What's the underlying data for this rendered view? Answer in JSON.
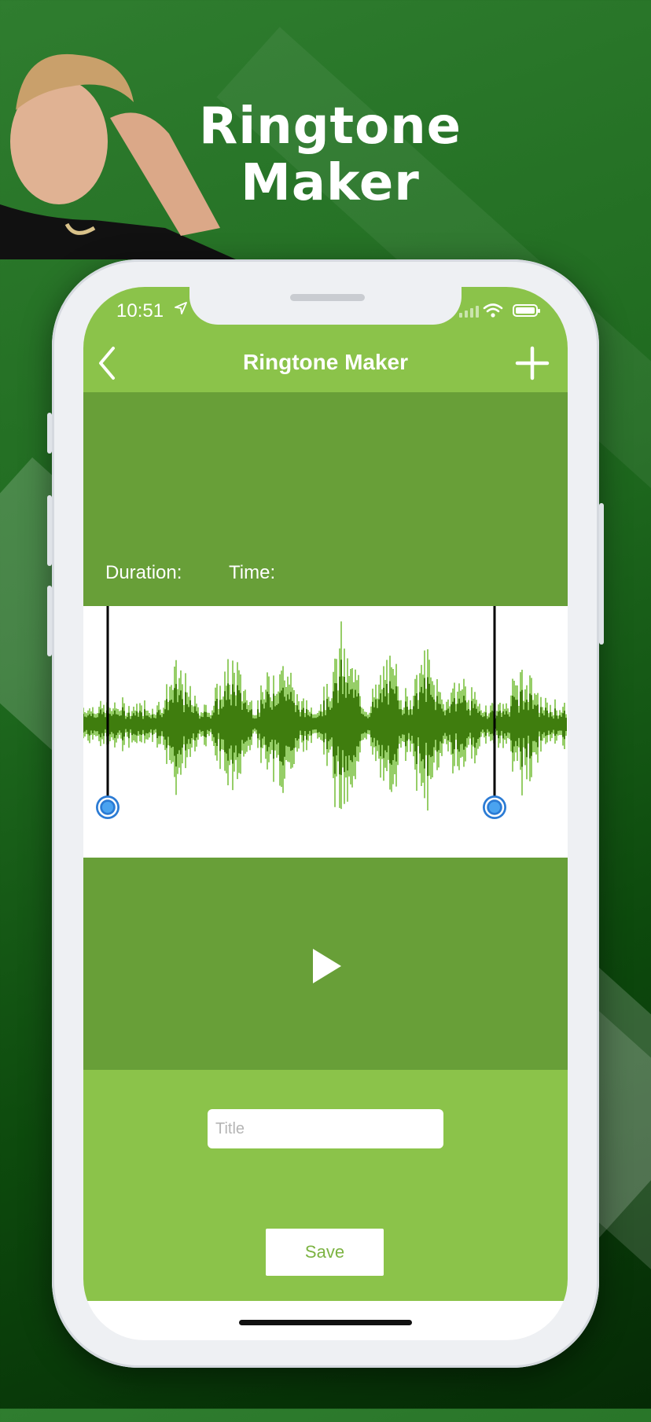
{
  "promo": {
    "title_line1": "Ringtone",
    "title_line2": "Maker"
  },
  "status_bar": {
    "time": "10:51"
  },
  "nav": {
    "title": "Ringtone Maker",
    "back_icon": "chevron-left-icon",
    "add_icon": "plus-icon"
  },
  "info": {
    "duration_label": "Duration:",
    "time_label": "Time:"
  },
  "waveform": {
    "color_dark": "#3f7d0e",
    "color_light": "#7cc142",
    "start_handle_icon": "range-handle-icon",
    "end_handle_icon": "range-handle-icon"
  },
  "player": {
    "play_icon": "play-icon"
  },
  "form": {
    "title_placeholder": "Title",
    "title_value": "",
    "save_label": "Save"
  },
  "colors": {
    "nav_green": "#8bc34a",
    "panel_green": "#689f38",
    "background_green": "#1f6a1f"
  }
}
